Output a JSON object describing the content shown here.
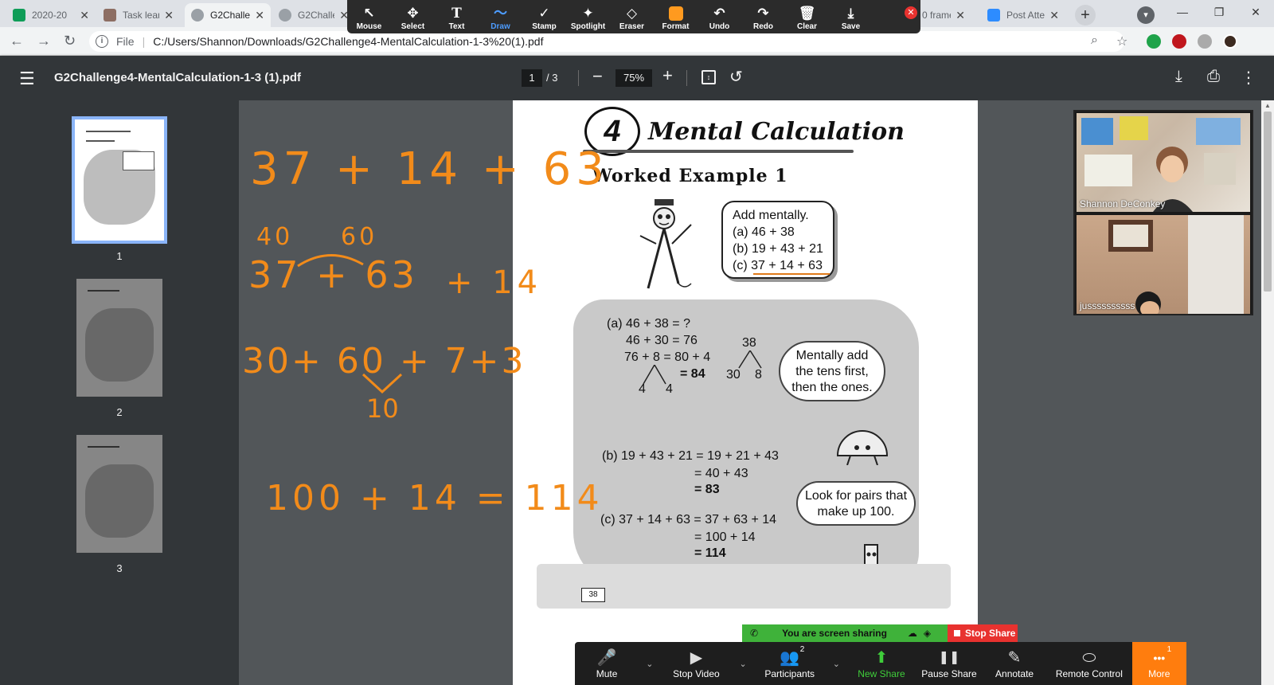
{
  "browser": {
    "tabs": [
      {
        "label": "2020-20",
        "color": "#0f9d58"
      },
      {
        "label": "Task lear",
        "color": "#8d6e63"
      },
      {
        "label": "G2Challe",
        "color": "#5f6368"
      },
      {
        "label": "G2Challe",
        "color": "#5f6368"
      },
      {
        "label": "0 frame",
        "color": "#5f6368"
      },
      {
        "label": "Post Atte",
        "color": "#2d8cff"
      }
    ],
    "new_tab": "+",
    "address": {
      "scheme": "File",
      "url": "C:/Users/Shannon/Downloads/G2Challenge4-MentalCalculation-1-3%20(1).pdf"
    }
  },
  "annotate_toolbar": {
    "tools": [
      {
        "label": "Mouse",
        "icon": "↖"
      },
      {
        "label": "Select",
        "icon": "✥"
      },
      {
        "label": "Text",
        "icon": "T"
      },
      {
        "label": "Draw",
        "icon": "〜"
      },
      {
        "label": "Stamp",
        "icon": "✓"
      },
      {
        "label": "Spotlight",
        "icon": "✦"
      },
      {
        "label": "Eraser",
        "icon": "◇"
      },
      {
        "label": "Format",
        "icon": ""
      },
      {
        "label": "Undo",
        "icon": "↶"
      },
      {
        "label": "Redo",
        "icon": "↷"
      },
      {
        "label": "Clear",
        "icon": "🗑"
      },
      {
        "label": "Save",
        "icon": "⤓"
      }
    ],
    "selected_tool": "Draw",
    "pen_color": "#ff9a1f"
  },
  "pdf_viewer": {
    "title": "G2Challenge4-MentalCalculation-1-3 (1).pdf",
    "current_page": "1",
    "total_pages": "/ 3",
    "zoom": "75%",
    "thumbnails": [
      "1",
      "2",
      "3"
    ]
  },
  "page": {
    "chapter_number": "4",
    "chapter_title": "Mental Calculation",
    "section": "Worked Example 1",
    "prompt": [
      "Add mentally.",
      "(a) 46 + 38",
      "(b) 19 + 43 + 21",
      "(c) 37 + 14 + 63"
    ],
    "work_a": {
      "l1": "(a) 46 + 38  = ?",
      "l2": "46 + 30  = 76",
      "l3": "76 + 8    = 80 + 4",
      "l4": "= 84",
      "split_left": "4",
      "split_right": "4",
      "tree_top": "38",
      "tree_left": "30",
      "tree_right": "8"
    },
    "hint_a": [
      "Mentally add",
      "the tens first,",
      "then the ones."
    ],
    "work_b": {
      "l1": "(b) 19 + 43 + 21 = 19 + 21 + 43",
      "l2": "= 40 + 43",
      "l3": "= 83"
    },
    "hint_c": [
      "Look for pairs that",
      "make up 100."
    ],
    "work_c": {
      "l1": "(c)  37 + 14 + 63 = 37 + 63 + 14",
      "l2": "= 100 + 14",
      "l3": "= 114"
    },
    "page_number": "38"
  },
  "handwriting": {
    "line1": "37 + 14 + 63",
    "tens_40": "40",
    "tens_60": "60",
    "line2": "37 + 63",
    "plus14": "+ 14",
    "line3": "30+ 60 + 7+3",
    "ten": "10",
    "line4": "100 + 14 = 114"
  },
  "participants": [
    {
      "name": "Shannon DeConkey"
    },
    {
      "name": "jussssssssss"
    }
  ],
  "share": {
    "status": "You are screen sharing",
    "stop_label": "Stop Share"
  },
  "meeting_bar": {
    "buttons": [
      {
        "label": "Mute",
        "icon": "🎤"
      },
      {
        "label": "Stop Video",
        "icon": "▶"
      },
      {
        "label": "Participants",
        "icon": "👥",
        "badge": "2"
      },
      {
        "label": "New Share",
        "icon": "⬆"
      },
      {
        "label": "Pause Share",
        "icon": "❚❚"
      },
      {
        "label": "Annotate",
        "icon": "✎"
      },
      {
        "label": "Remote Control",
        "icon": "⬭"
      },
      {
        "label": "More",
        "icon": "•••",
        "badge": "1"
      }
    ]
  }
}
